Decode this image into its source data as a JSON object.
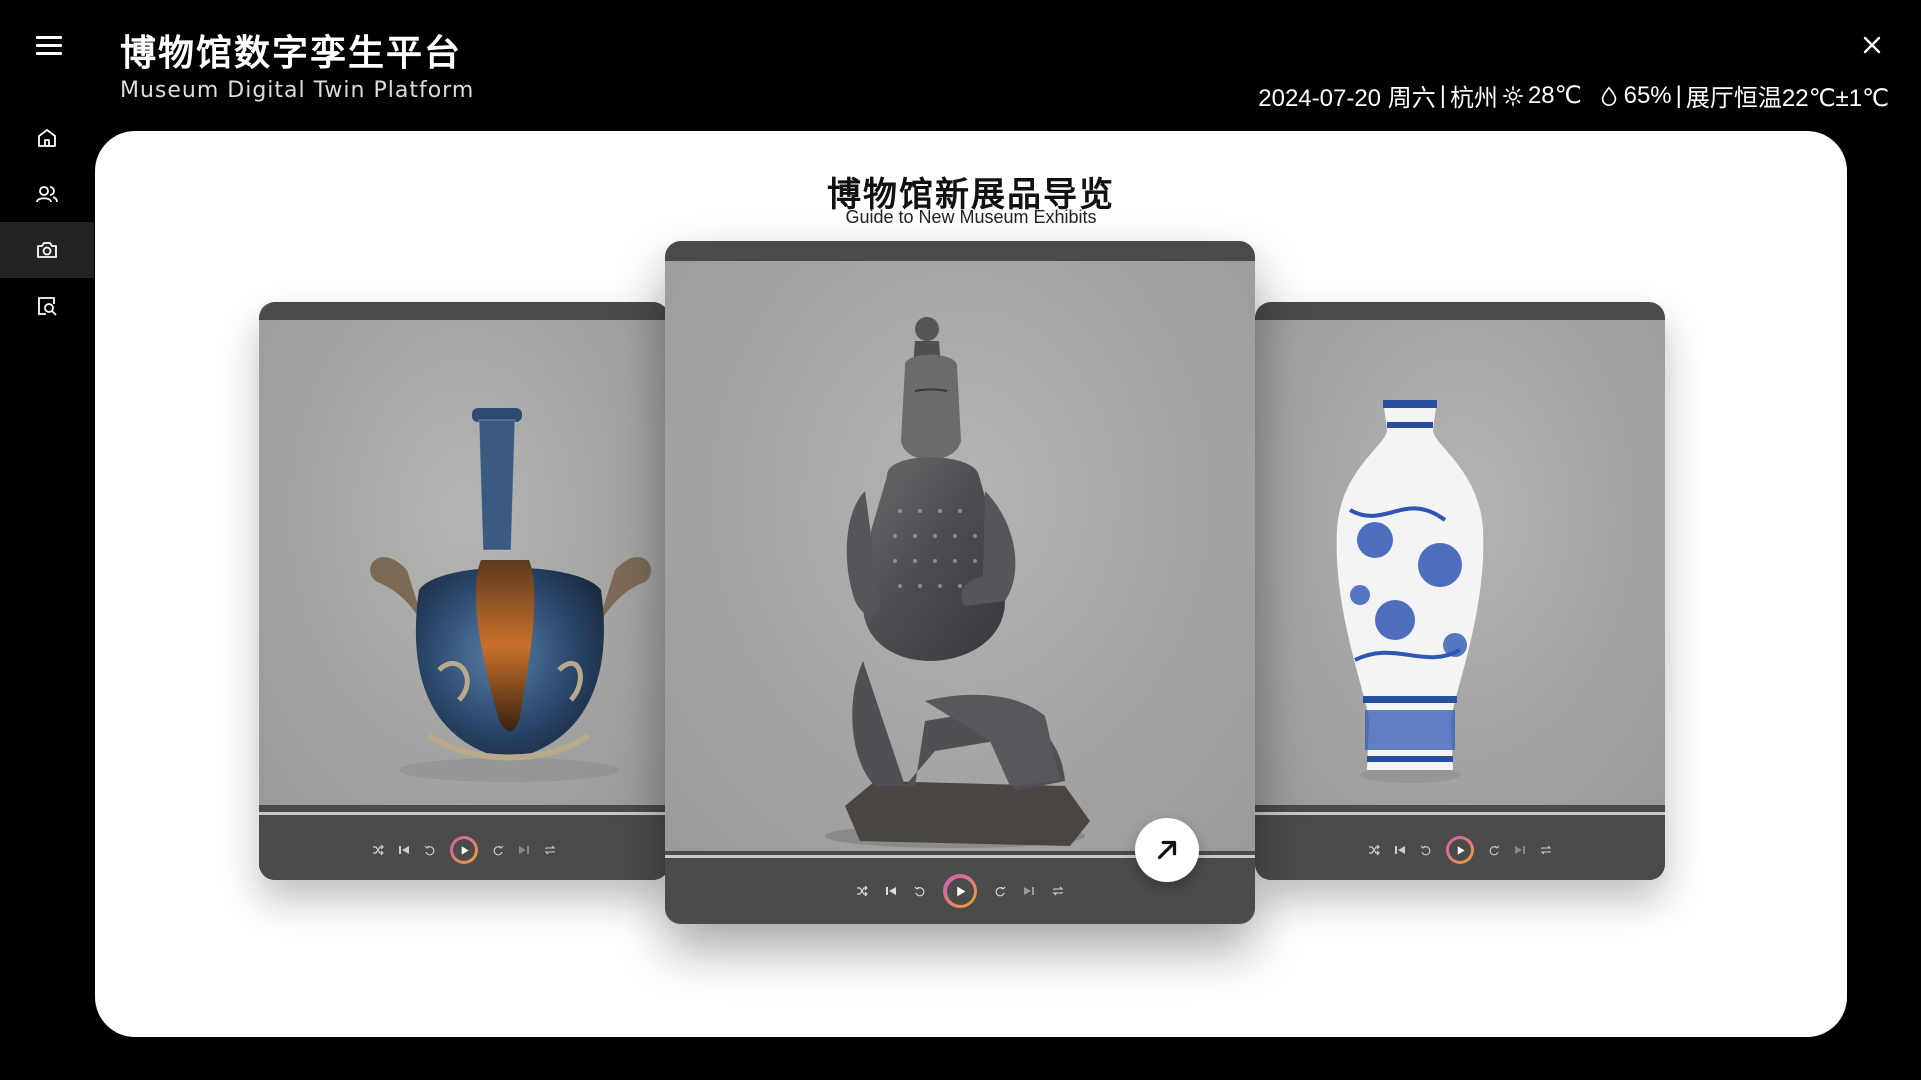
{
  "app": {
    "title": "博物馆数字孪生平台",
    "subtitle": "Museum Digital Twin Platform"
  },
  "status": {
    "date": "2024-07-20 周六",
    "city": "杭州",
    "temperature": "28℃",
    "humidity": "65%",
    "hall_temp": "展厅恒温22℃±1℃",
    "separator": "|"
  },
  "sidebar": {
    "items": [
      {
        "icon": "home-icon",
        "active": false
      },
      {
        "icon": "users-icon",
        "active": false
      },
      {
        "icon": "camera-icon",
        "active": true
      },
      {
        "icon": "search-document-icon",
        "active": false
      }
    ]
  },
  "panel": {
    "title": "博物馆新展品导览",
    "subtitle": "Guide to New Museum Exhibits"
  },
  "cards": [
    {
      "position": "left",
      "exhibit_icon": "blue-glazed-ewer-image"
    },
    {
      "position": "center",
      "exhibit_icon": "terracotta-warrior-image"
    },
    {
      "position": "right",
      "exhibit_icon": "blue-white-porcelain-vase-image"
    }
  ],
  "colors": {
    "background": "#000000",
    "panel": "#ffffff",
    "card": "#4a4a4a",
    "stage": "#a8a8a6",
    "play_ring_start": "#d05ab9",
    "play_ring_end": "#f0a033"
  }
}
